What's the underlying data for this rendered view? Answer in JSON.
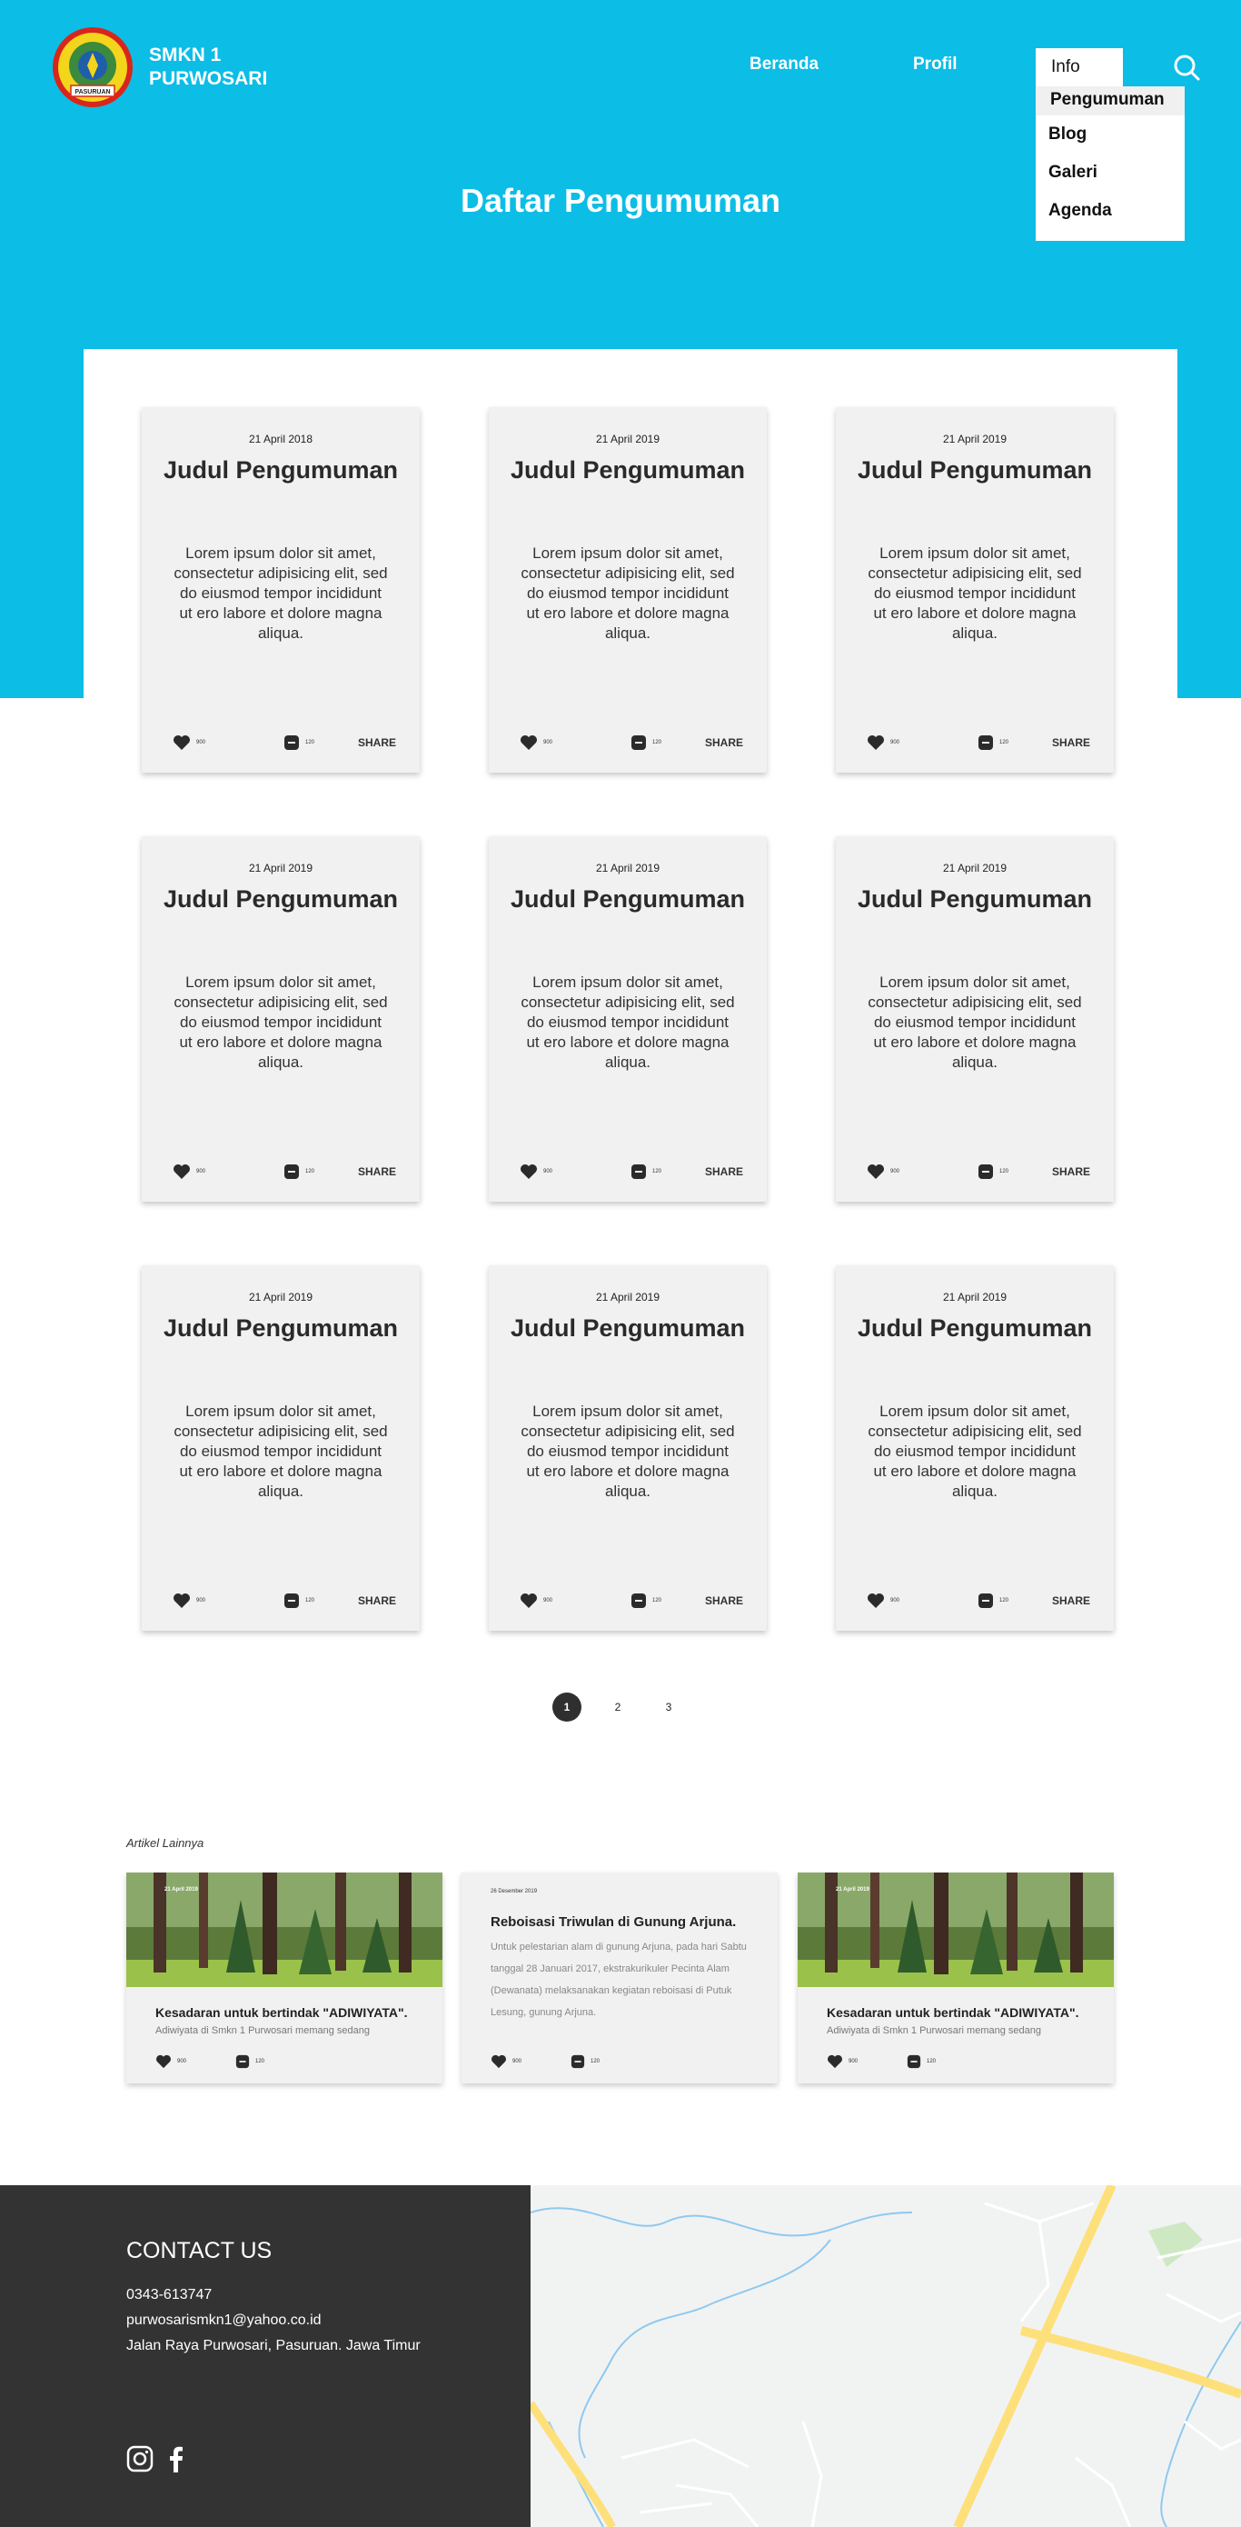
{
  "header": {
    "school_name_line1": "SMKN 1",
    "school_name_line2": "PURWOSARI",
    "logo_text": "PASURUAN",
    "nav": {
      "home": "Beranda",
      "profile": "Profil",
      "info": "Info"
    },
    "dropdown": [
      "Pengumuman",
      "Blog",
      "Galeri",
      "Agenda"
    ]
  },
  "page": {
    "title": "Daftar Pengumuman"
  },
  "cards": [
    {
      "date": "21 April 2018",
      "title": "Judul Pengumuman",
      "body": "Lorem ipsum dolor sit amet, consectetur adipisicing elit, sed do eiusmod tempor incididunt ut ero labore et dolore magna aliqua.",
      "likes": "900",
      "comments": "120",
      "share": "SHARE"
    },
    {
      "date": "21 April 2019",
      "title": "Judul Pengumuman",
      "body": "Lorem ipsum dolor sit amet, consectetur adipisicing elit, sed do eiusmod tempor incididunt ut ero labore et dolore magna aliqua.",
      "likes": "900",
      "comments": "120",
      "share": "SHARE"
    },
    {
      "date": "21 April 2019",
      "title": "Judul Pengumuman",
      "body": "Lorem ipsum dolor sit amet, consectetur adipisicing elit, sed do eiusmod tempor incididunt ut ero labore et dolore magna aliqua.",
      "likes": "900",
      "comments": "120",
      "share": "SHARE"
    },
    {
      "date": "21 April 2019",
      "title": "Judul Pengumuman",
      "body": "Lorem ipsum dolor sit amet, consectetur adipisicing elit, sed do eiusmod tempor incididunt ut ero labore et dolore magna aliqua.",
      "likes": "900",
      "comments": "120",
      "share": "SHARE"
    },
    {
      "date": "21 April 2019",
      "title": "Judul Pengumuman",
      "body": "Lorem ipsum dolor sit amet, consectetur adipisicing elit, sed do eiusmod tempor incididunt ut ero labore et dolore magna aliqua.",
      "likes": "900",
      "comments": "120",
      "share": "SHARE"
    },
    {
      "date": "21 April 2019",
      "title": "Judul Pengumuman",
      "body": "Lorem ipsum dolor sit amet, consectetur adipisicing elit, sed do eiusmod tempor incididunt ut ero labore et dolore magna aliqua.",
      "likes": "900",
      "comments": "120",
      "share": "SHARE"
    },
    {
      "date": "21 April 2019",
      "title": "Judul Pengumuman",
      "body": "Lorem ipsum dolor sit amet, consectetur adipisicing elit, sed do eiusmod tempor incididunt ut ero labore et dolore magna aliqua.",
      "likes": "900",
      "comments": "120",
      "share": "SHARE"
    },
    {
      "date": "21 April 2019",
      "title": "Judul Pengumuman",
      "body": "Lorem ipsum dolor sit amet, consectetur adipisicing elit, sed do eiusmod tempor incididunt ut ero labore et dolore magna aliqua.",
      "likes": "900",
      "comments": "120",
      "share": "SHARE"
    },
    {
      "date": "21 April 2019",
      "title": "Judul Pengumuman",
      "body": "Lorem ipsum dolor sit amet, consectetur adipisicing elit, sed do eiusmod tempor incididunt ut ero labore et dolore magna aliqua.",
      "likes": "900",
      "comments": "120",
      "share": "SHARE"
    }
  ],
  "pagination": {
    "pages": [
      "1",
      "2",
      "3"
    ],
    "current": "1"
  },
  "related": {
    "heading": "Artikel Lainnya",
    "items": [
      {
        "date": "21 April 2019",
        "title": "Kesadaran untuk bertindak \"ADIWIYATA\".",
        "excerpt": "Adiwiyata  di Smkn 1 Purwosari memang sedang",
        "likes": "900",
        "comments": "120"
      },
      {
        "date": "26 Desember 2019",
        "title": "Reboisasi Triwulan di Gunung Arjuna.",
        "excerpt": "Untuk pelestarian alam di gunung Arjuna, pada hari Sabtu tanggal 28 Januari 2017, ekstrakurikuler Pecinta Alam (Dewanata) melaksanakan kegiatan reboisasi di Putuk Lesung, gunung Arjuna.",
        "likes": "900",
        "comments": "120"
      },
      {
        "date": "21 April 2019",
        "title": "Kesadaran untuk bertindak \"ADIWIYATA\".",
        "excerpt": "Adiwiyata  di Smkn 1 Purwosari memang sedang",
        "likes": "900",
        "comments": "120"
      }
    ]
  },
  "footer": {
    "contact_title": "CONTACT US",
    "phone": "0343-613747",
    "email": "purwosarismkn1@yahoo.co.id",
    "address": "Jalan Raya Purwosari, Pasuruan. Jawa Timur"
  },
  "colors": {
    "accent": "#0cbde6",
    "footer_dark": "#333333",
    "card_bg": "#f1f1f1"
  }
}
